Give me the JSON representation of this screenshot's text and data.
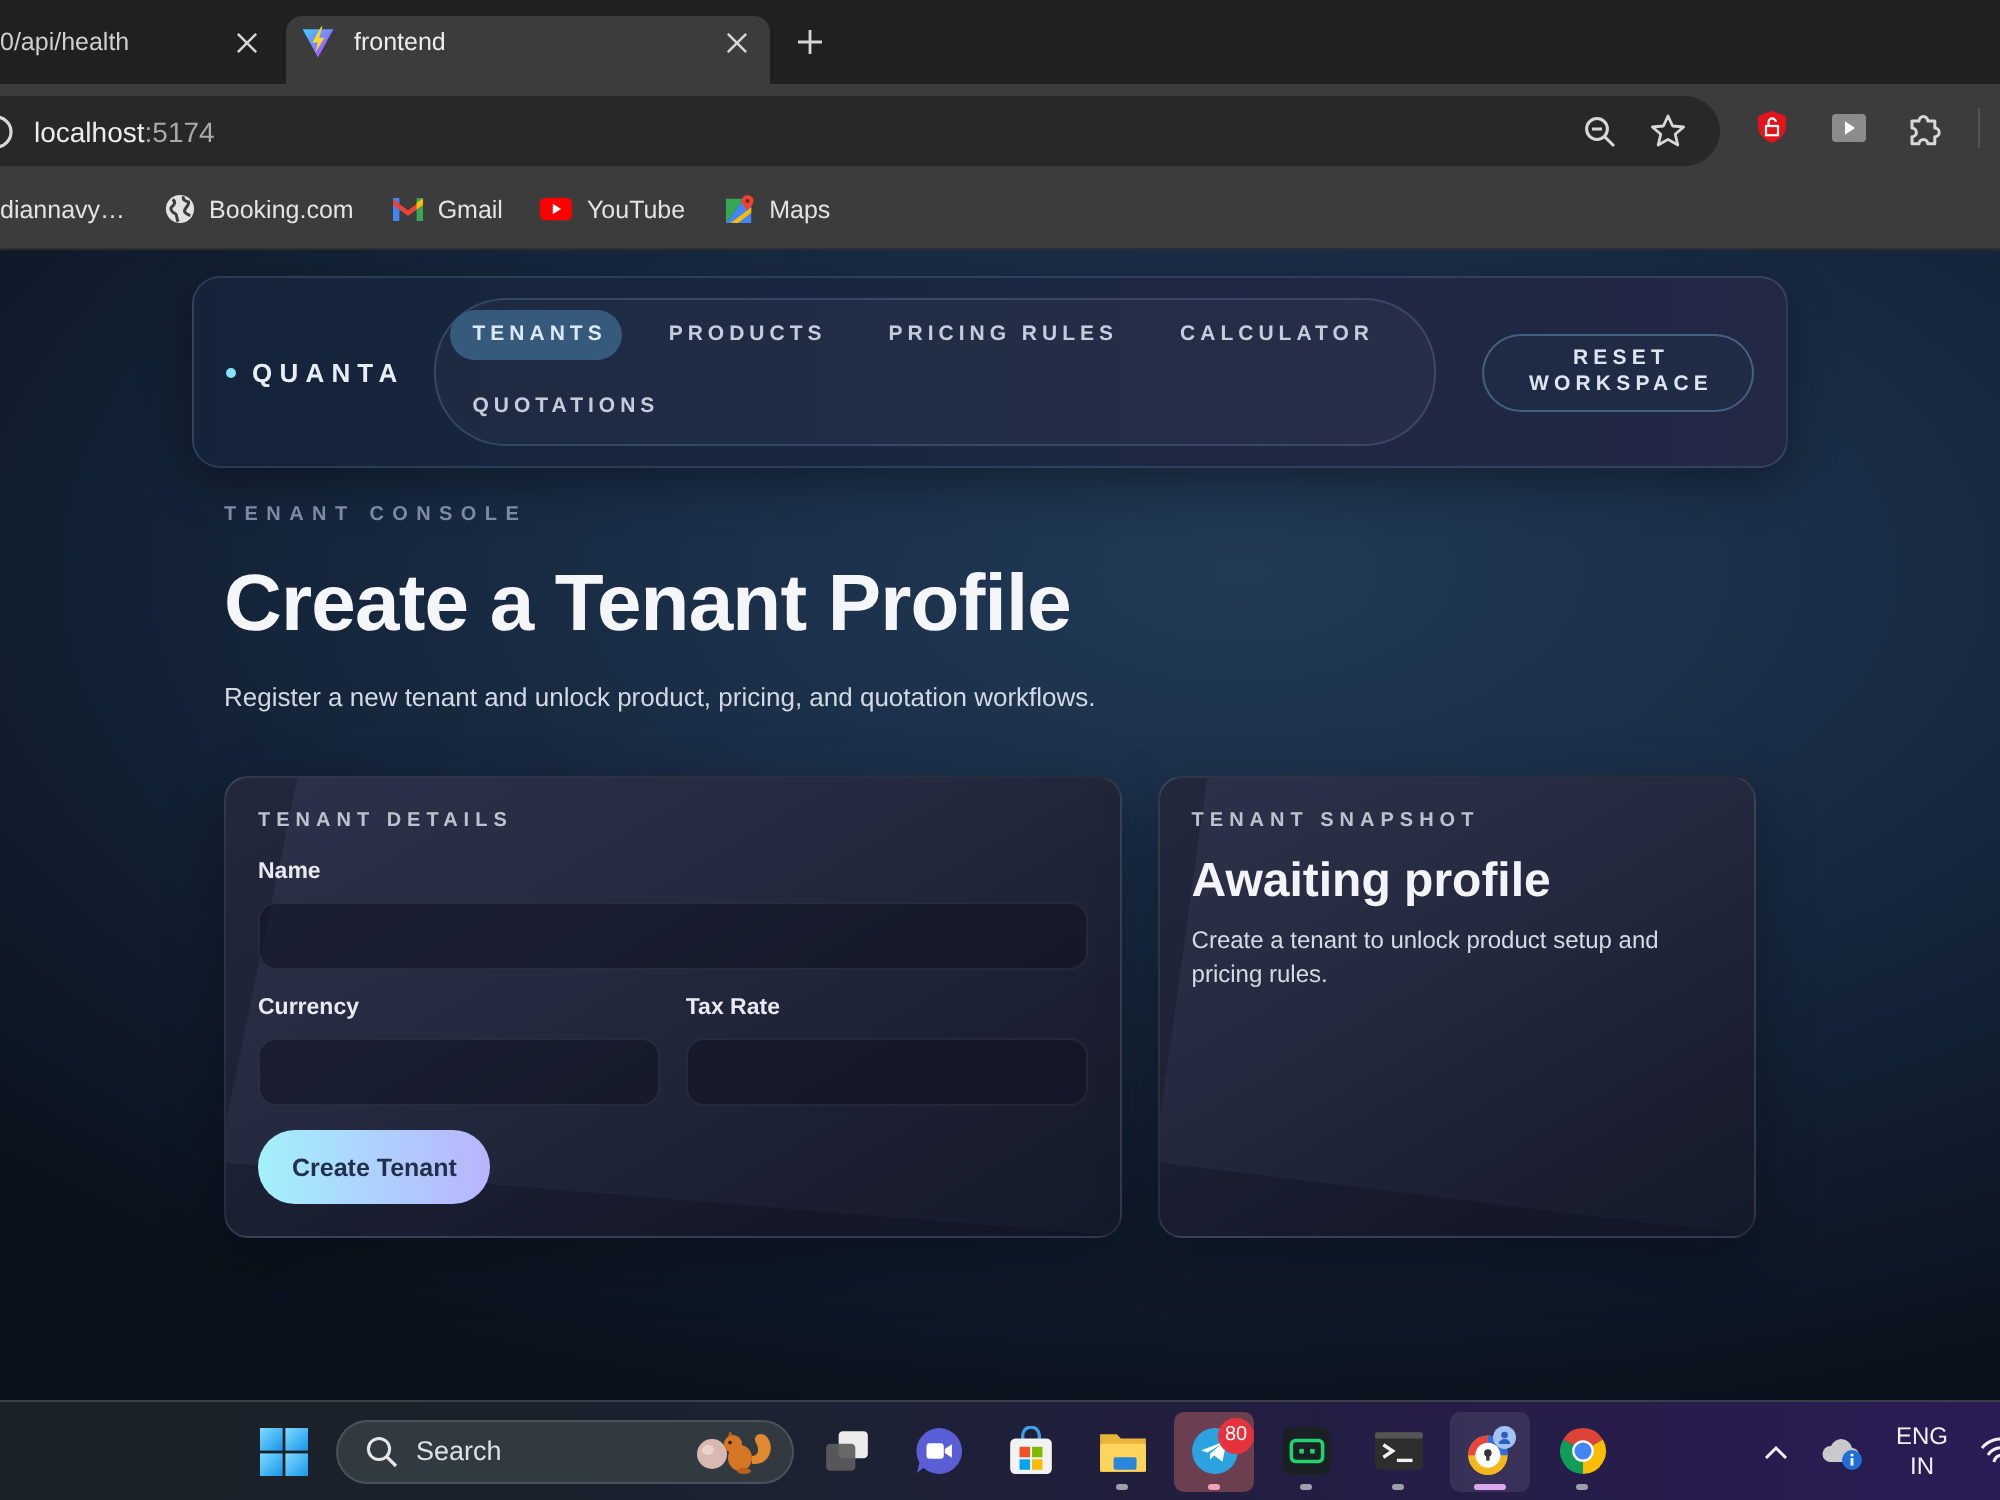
{
  "browser": {
    "tabs": [
      {
        "title": "0/api/health",
        "selected": false
      },
      {
        "title": "frontend",
        "selected": true
      }
    ],
    "address": {
      "host": "localhost",
      "port": ":5174"
    },
    "bookmarks": [
      {
        "label": "diannavy…"
      },
      {
        "label": "Booking.com"
      },
      {
        "label": "Gmail"
      },
      {
        "label": "YouTube"
      },
      {
        "label": "Maps"
      }
    ]
  },
  "nav": {
    "brand": "QUANTA",
    "items": [
      {
        "label": "TENANTS",
        "selected": true
      },
      {
        "label": "PRODUCTS",
        "selected": false
      },
      {
        "label": "PRICING RULES",
        "selected": false
      },
      {
        "label": "CALCULATOR",
        "selected": false
      },
      {
        "label": "QUOTATIONS",
        "selected": false
      }
    ],
    "reset_button": "RESET WORKSPACE"
  },
  "header": {
    "eyebrow": "TENANT CONSOLE",
    "title": "Create a Tenant Profile",
    "subtitle": "Register a new tenant and unlock product, pricing, and quotation workflows."
  },
  "tenant_details": {
    "heading": "TENANT DETAILS",
    "field_rows": [
      {
        "fields": [
          {
            "label": "Name"
          }
        ]
      },
      {
        "fields": [
          {
            "label": "Currency"
          },
          {
            "label": "Tax Rate"
          }
        ]
      }
    ],
    "submit_button": "Create Tenant"
  },
  "tenant_snapshot": {
    "heading": "TENANT SNAPSHOT",
    "title": "Awaiting profile",
    "text": "Create a tenant to unlock product setup and pricing rules."
  },
  "taskbar": {
    "search": {
      "placeholder": "Search"
    },
    "apps": [
      {
        "running": false,
        "attention": false,
        "selected": false
      },
      {
        "running": false,
        "attention": false,
        "selected": false
      },
      {
        "running": false,
        "attention": false,
        "selected": false
      },
      {
        "running": true,
        "attention": false,
        "selected": false
      },
      {
        "running": true,
        "attention": true,
        "selected": false,
        "badge": "80"
      },
      {
        "running": true,
        "attention": false,
        "selected": false
      },
      {
        "running": true,
        "attention": false,
        "selected": false
      },
      {
        "running": true,
        "attention": false,
        "selected": true
      },
      {
        "running": true,
        "attention": false,
        "selected": false
      }
    ],
    "input_language": {
      "language": "ENG",
      "region": "IN"
    }
  }
}
